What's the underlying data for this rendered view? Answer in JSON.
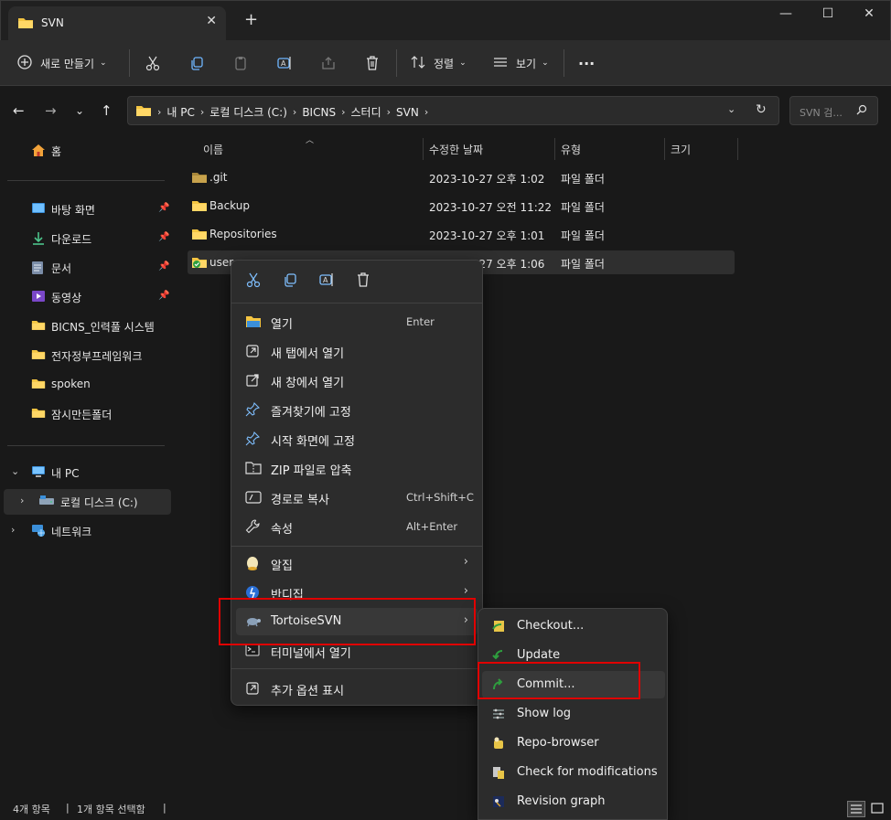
{
  "window": {
    "tab_title": "SVN",
    "tab_close": "✕",
    "new_tab": "+",
    "minimize": "—",
    "maximize": "☐",
    "close": "✕"
  },
  "toolbar": {
    "new_label": "새로 만들기",
    "sort_label": "정렬",
    "view_label": "보기",
    "more_label": "···"
  },
  "address": {
    "crumbs": [
      "내 PC",
      "로컬 디스크 (C:)",
      "BICNS",
      "스터디",
      "SVN"
    ],
    "search_placeholder": "SVN 검..."
  },
  "sidebar": {
    "home": "홈",
    "quick": [
      {
        "label": "바탕 화면",
        "pinned": true
      },
      {
        "label": "다운로드",
        "pinned": true
      },
      {
        "label": "문서",
        "pinned": true
      },
      {
        "label": "동영상",
        "pinned": true
      },
      {
        "label": "BICNS_인력풀 시스템",
        "pinned": false
      },
      {
        "label": "전자정부프레임워크",
        "pinned": false
      },
      {
        "label": "spoken",
        "pinned": false
      },
      {
        "label": "잠시만든폴더",
        "pinned": false
      }
    ],
    "this_pc": "내 PC",
    "local_disk": "로컬 디스크 (C:)",
    "network": "네트워크"
  },
  "columns": {
    "name": "이름",
    "modified": "수정한 날짜",
    "type": "유형",
    "size": "크기"
  },
  "files": [
    {
      "name": ".git",
      "modified": "2023-10-27 오후 1:02",
      "type": "파일 폴더"
    },
    {
      "name": "Backup",
      "modified": "2023-10-27 오전 11:22",
      "type": "파일 폴더"
    },
    {
      "name": "Repositories",
      "modified": "2023-10-27 오후 1:01",
      "type": "파일 폴더"
    },
    {
      "name": "user",
      "modified": "2023-10-27 오후 1:06",
      "type": "파일 폴더"
    }
  ],
  "context_menu": {
    "items": [
      {
        "label": "열기",
        "shortcut": "Enter"
      },
      {
        "label": "새 탭에서 열기",
        "shortcut": ""
      },
      {
        "label": "새 창에서 열기",
        "shortcut": ""
      },
      {
        "label": "즐겨찾기에 고정",
        "shortcut": ""
      },
      {
        "label": "시작 화면에 고정",
        "shortcut": ""
      },
      {
        "label": "ZIP 파일로 압축",
        "shortcut": ""
      },
      {
        "label": "경로로 복사",
        "shortcut": "Ctrl+Shift+C"
      },
      {
        "label": "속성",
        "shortcut": "Alt+Enter"
      }
    ],
    "alzip": "알집",
    "bandizip": "반디집",
    "tortoisesvn": "TortoiseSVN",
    "terminal": "터미널에서 열기",
    "more_options": "추가 옵션 표시",
    "arrow": "›"
  },
  "svn_submenu": {
    "items": [
      "Checkout...",
      "Update",
      "Commit...",
      "Show log",
      "Repo-browser",
      "Check for modifications",
      "Revision graph"
    ]
  },
  "status": {
    "count": "4개 항목",
    "selected": "1개 항목 선택함",
    "bar": "|"
  },
  "colors": {
    "highlight": "#e00000",
    "folder": "#f4c542"
  }
}
